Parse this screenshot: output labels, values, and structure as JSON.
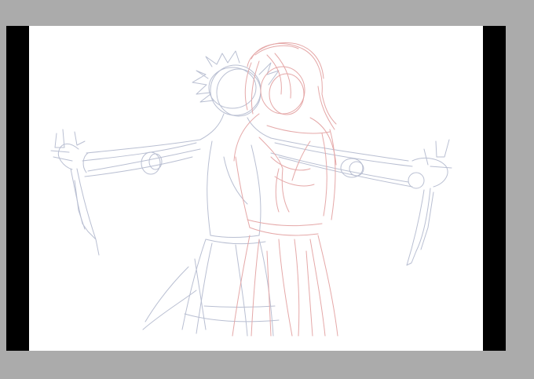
{
  "app": {
    "background_color": "#ababab",
    "letterbox_color": "#000000",
    "canvas_color": "#ffffff"
  },
  "sketch": {
    "layers": [
      {
        "color": "#b9bfd2"
      },
      {
        "color": "#e5a8a8"
      }
    ]
  }
}
